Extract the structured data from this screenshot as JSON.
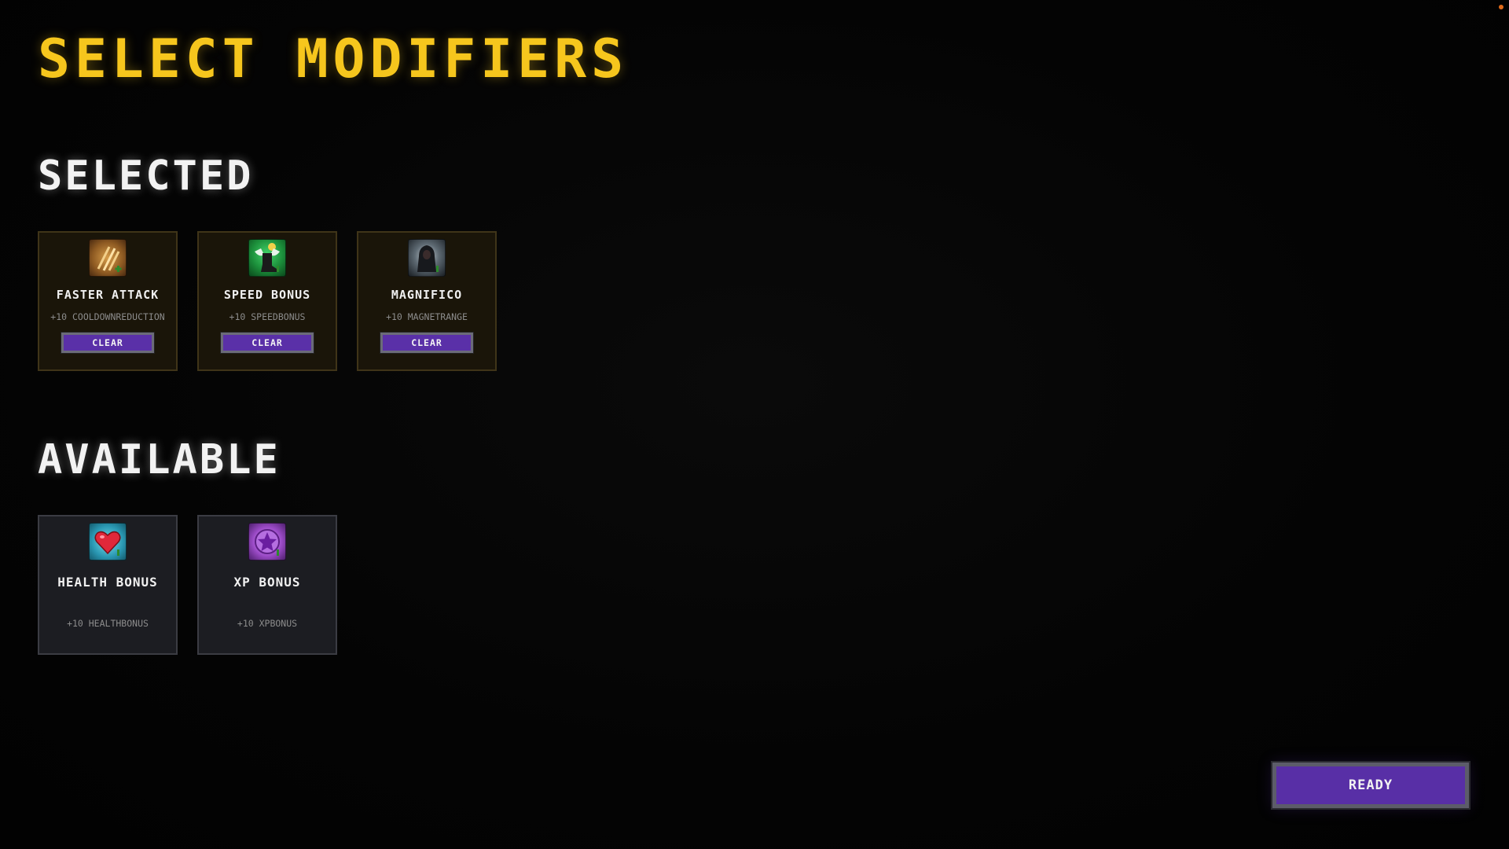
{
  "screen": {
    "title": "SELECT MODIFIERS"
  },
  "selected": {
    "heading": "SELECTED",
    "cards": [
      {
        "name": "FASTER ATTACK",
        "desc": "+10 COOLDOWNREDUCTION",
        "icon": "claw-slash-icon",
        "button_label": "CLEAR"
      },
      {
        "name": "SPEED BONUS",
        "desc": "+10 SPEEDBONUS",
        "icon": "winged-boot-icon",
        "button_label": "CLEAR"
      },
      {
        "name": "MAGNIFICO",
        "desc": "+10 MAGNETRANGE",
        "icon": "hooded-figure-icon",
        "button_label": "CLEAR"
      }
    ]
  },
  "available": {
    "heading": "AVAILABLE",
    "cards": [
      {
        "name": "HEALTH BONUS",
        "desc": "+10 HEALTHBONUS",
        "icon": "heart-icon"
      },
      {
        "name": "XP BONUS",
        "desc": "+10 XPBONUS",
        "icon": "xp-gem-icon"
      }
    ]
  },
  "ready_button": {
    "label": "READY"
  },
  "colors": {
    "title": "#f6c61d",
    "button": "#582fa6",
    "selected_card_bg": "#1a1509",
    "available_card_bg": "#1c1d22"
  }
}
